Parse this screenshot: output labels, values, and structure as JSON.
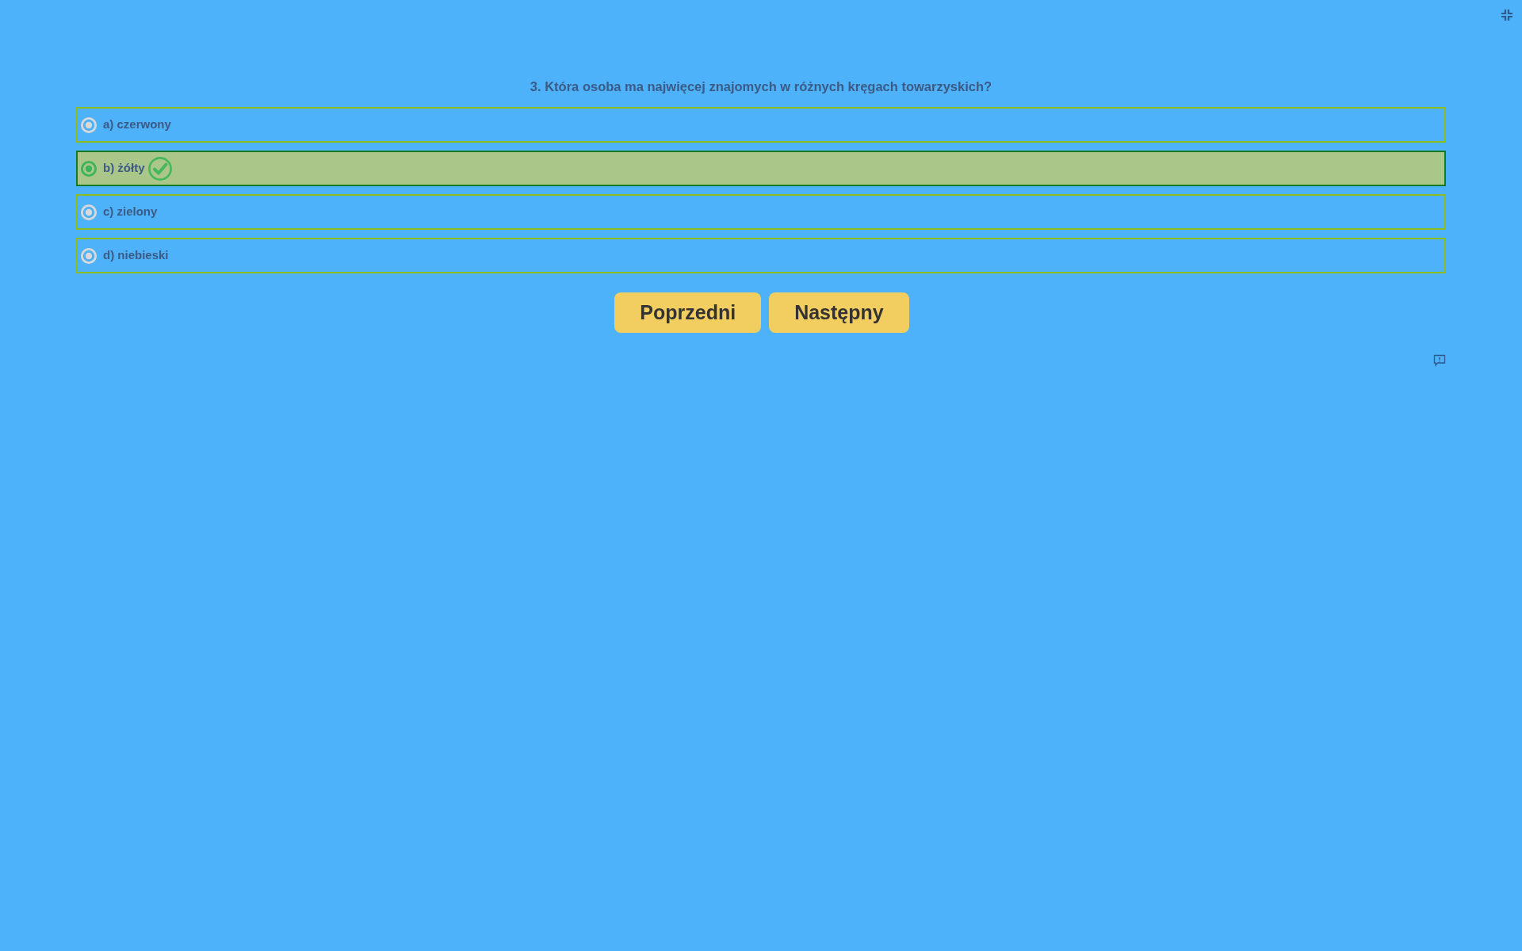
{
  "question": "3. Która osoba ma najwięcej znajomych w różnych kręgach towarzyskich?",
  "options": [
    {
      "label": "a) czerwony",
      "selected": false,
      "correct": false
    },
    {
      "label": "b) żółty",
      "selected": true,
      "correct": true
    },
    {
      "label": "c) zielony",
      "selected": false,
      "correct": false
    },
    {
      "label": "d) niebieski",
      "selected": false,
      "correct": false
    }
  ],
  "buttons": [
    {
      "label": "Poprzedni"
    },
    {
      "label": "Następny"
    }
  ]
}
